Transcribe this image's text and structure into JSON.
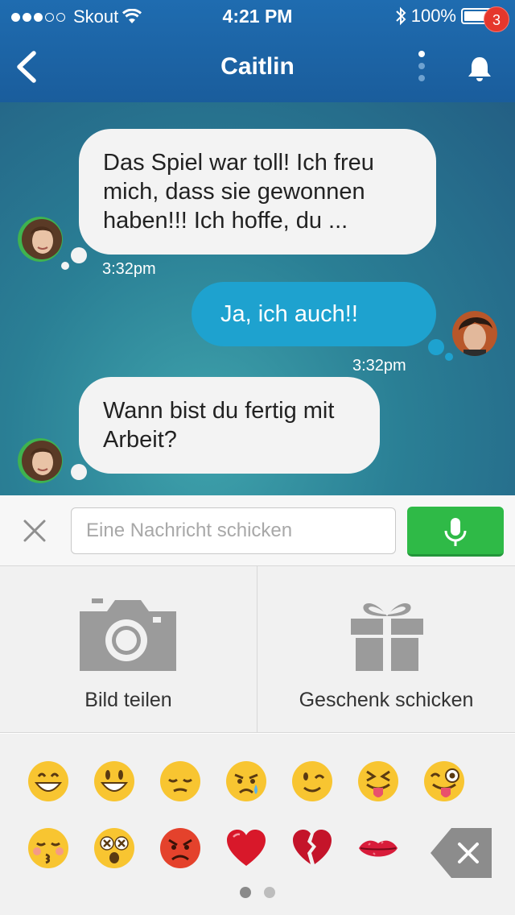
{
  "status_bar": {
    "carrier": "Skout",
    "time": "4:21 PM",
    "battery": "100%"
  },
  "nav": {
    "title": "Caitlin",
    "notification_count": "3"
  },
  "messages": [
    {
      "direction": "incoming",
      "text": "Das Spiel war toll! Ich freu mich, dass sie gewonnen haben!!! Ich hoffe, du ...",
      "time": "3:32pm"
    },
    {
      "direction": "outgoing",
      "text": "Ja, ich auch!!",
      "time": "3:32pm"
    },
    {
      "direction": "incoming",
      "text": "Wann bist du fertig mit Arbeit?",
      "time": ""
    }
  ],
  "composer": {
    "placeholder": "Eine Nachricht schicken"
  },
  "actions": {
    "share_photo": "Bild teilen",
    "send_gift": "Geschenk schicken"
  },
  "emoji": {
    "row1": [
      "grinning",
      "smiley",
      "pensive",
      "crying",
      "winking",
      "tongue-squint",
      "tongue-wink"
    ],
    "row2": [
      "kissing-closed-eyes",
      "dizzy",
      "angry",
      "red-heart",
      "broken-heart",
      "kiss-lips"
    ],
    "pages": 2,
    "current_page": 1
  },
  "colors": {
    "nav_blue": "#1f6cb0",
    "outgoing_bubble": "#1ea2cf",
    "mic_green": "#2fba47",
    "badge_red": "#e5372c"
  }
}
